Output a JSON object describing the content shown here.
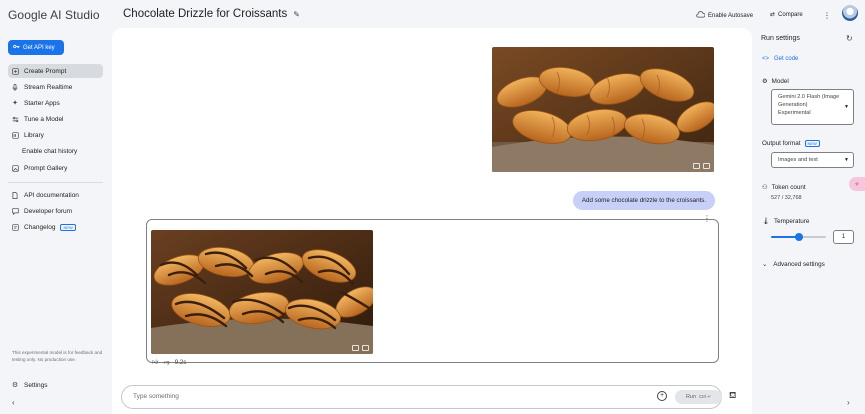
{
  "app": {
    "name": "Google AI Studio",
    "prompt_title": "Chocolate Drizzle for Croissants"
  },
  "sidebar": {
    "get_api_key": "Get API key",
    "items": [
      {
        "label": "Create Prompt",
        "icon": "create-prompt-icon"
      },
      {
        "label": "Stream Realtime",
        "icon": "microphone-icon"
      },
      {
        "label": "Starter Apps",
        "icon": "sparkle-icon"
      },
      {
        "label": "Tune a Model",
        "icon": "tune-icon"
      },
      {
        "label": "Library",
        "icon": "library-icon"
      },
      {
        "label": "Enable chat history",
        "icon": "none"
      },
      {
        "label": "Prompt Gallery",
        "icon": "gallery-icon"
      }
    ],
    "resources": [
      {
        "label": "API documentation",
        "icon": "document-icon"
      },
      {
        "label": "Developer forum",
        "icon": "forum-icon"
      },
      {
        "label": "Changelog",
        "icon": "changelog-icon",
        "badge": "NEW"
      }
    ],
    "disclaimer": "This experimental model is for feedback and testing only. No production use.",
    "settings": "Settings"
  },
  "header": {
    "autosave": "Enable Autosave",
    "compare": "Compare"
  },
  "chat": {
    "user_message": "Add some chocolate drizzle to the croissants.",
    "response_time": "9.2s",
    "input_placeholder": "Type something",
    "run_label": "Run",
    "run_shortcut": "Ctrl ↵"
  },
  "run_settings": {
    "title": "Run settings",
    "get_code": "Get code",
    "model_label": "Model",
    "model_value": "Gemini 2.0 Flash (Image Generation) Experimental",
    "output_format_label": "Output format",
    "output_format_badge": "NEW",
    "output_format_value": "Images and text",
    "token_count_label": "Token count",
    "token_count_value": "527 / 32,768",
    "temperature_label": "Temperature",
    "temperature_value": "1",
    "temperature_fraction": 0.5,
    "advanced_settings": "Advanced settings"
  },
  "colors": {
    "accent": "#1a73e8",
    "user_bubble": "#c8cff9",
    "sidebar_bg": "#f3f5f8"
  }
}
